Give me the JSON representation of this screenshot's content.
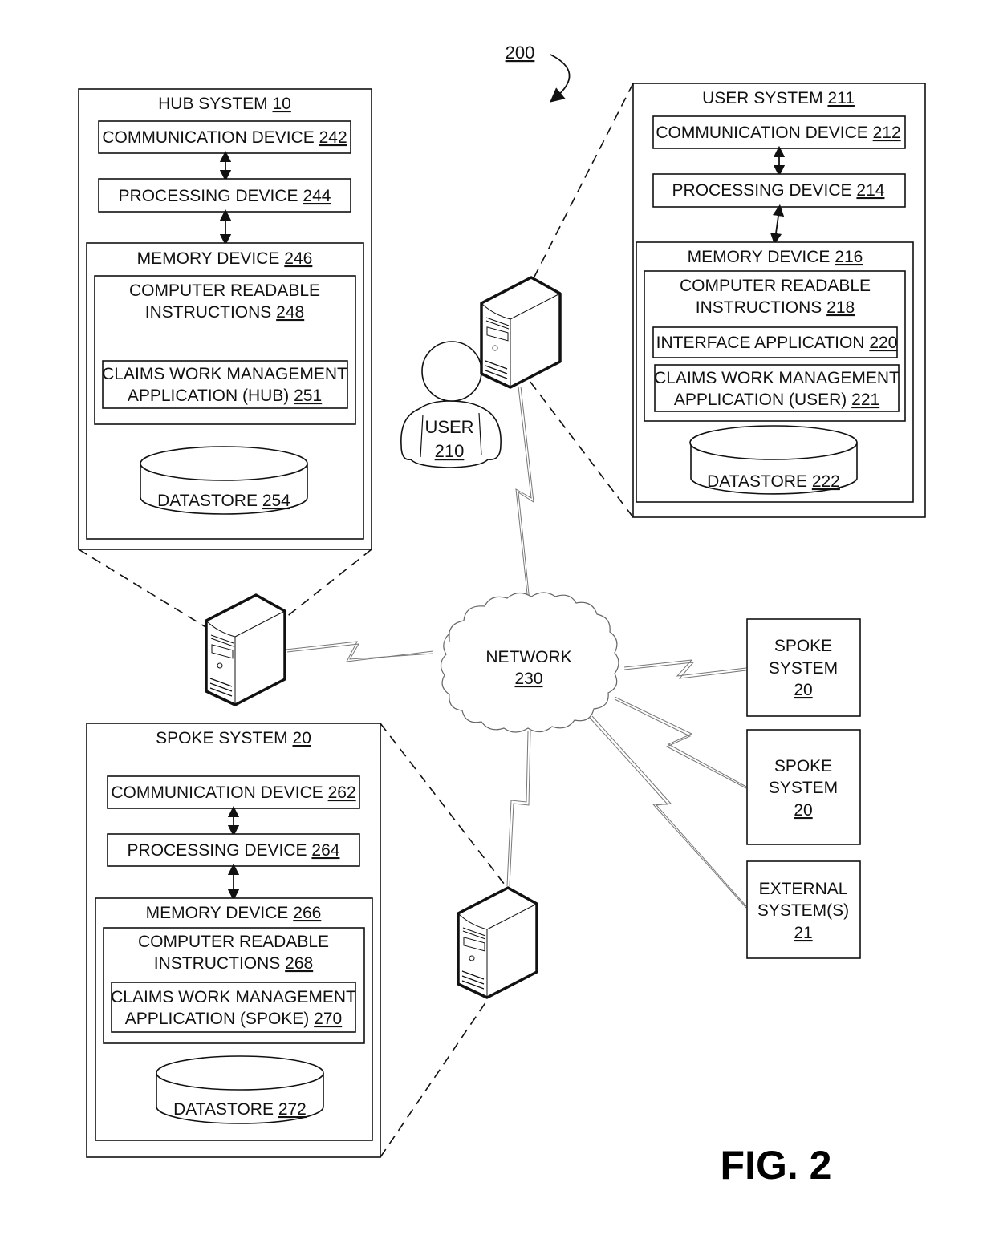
{
  "figure": {
    "ref_number": "200",
    "caption": "FIG. 2"
  },
  "hub_system": {
    "title": "HUB SYSTEM",
    "title_ref": "10",
    "communication_device": {
      "label": "COMMUNICATION DEVICE",
      "ref": "242"
    },
    "processing_device": {
      "label": "PROCESSING DEVICE",
      "ref": "244"
    },
    "memory_device": {
      "label": "MEMORY DEVICE",
      "ref": "246"
    },
    "instructions": {
      "line1": "COMPUTER READABLE",
      "line2": "INSTRUCTIONS",
      "ref": "248"
    },
    "application": {
      "line1": "CLAIMS WORK MANAGEMENT",
      "line2": "APPLICATION (HUB)",
      "ref": "251"
    },
    "datastore": {
      "label": "DATASTORE",
      "ref": "254"
    }
  },
  "user_system": {
    "title": "USER SYSTEM",
    "title_ref": "211",
    "communication_device": {
      "label": "COMMUNICATION DEVICE",
      "ref": "212"
    },
    "processing_device": {
      "label": "PROCESSING DEVICE",
      "ref": "214"
    },
    "memory_device": {
      "label": "MEMORY DEVICE",
      "ref": "216"
    },
    "instructions": {
      "line1": "COMPUTER READABLE",
      "line2": "INSTRUCTIONS",
      "ref": "218"
    },
    "interface_application": {
      "label": "INTERFACE APPLICATION",
      "ref": "220"
    },
    "application": {
      "line1": "CLAIMS WORK MANAGEMENT",
      "line2": "APPLICATION (USER)",
      "ref": "221"
    },
    "datastore": {
      "label": "DATASTORE",
      "ref": "222"
    }
  },
  "spoke_system_detail": {
    "title": "SPOKE SYSTEM",
    "title_ref": "20",
    "communication_device": {
      "label": "COMMUNICATION DEVICE",
      "ref": "262"
    },
    "processing_device": {
      "label": "PROCESSING DEVICE",
      "ref": "264"
    },
    "memory_device": {
      "label": "MEMORY DEVICE",
      "ref": "266"
    },
    "instructions": {
      "line1": "COMPUTER READABLE",
      "line2": "INSTRUCTIONS",
      "ref": "268"
    },
    "application": {
      "line1": "CLAIMS WORK MANAGEMENT",
      "line2": "APPLICATION (SPOKE)",
      "ref": "270"
    },
    "datastore": {
      "label": "DATASTORE",
      "ref": "272"
    }
  },
  "user": {
    "label": "USER",
    "ref": "210"
  },
  "network": {
    "label": "NETWORK",
    "ref": "230"
  },
  "side_systems": [
    {
      "line1": "SPOKE",
      "line2": "SYSTEM",
      "ref": "20"
    },
    {
      "line1": "SPOKE",
      "line2": "SYSTEM",
      "ref": "20"
    },
    {
      "line1": "EXTERNAL",
      "line2": "SYSTEM(S)",
      "ref": "21"
    }
  ]
}
